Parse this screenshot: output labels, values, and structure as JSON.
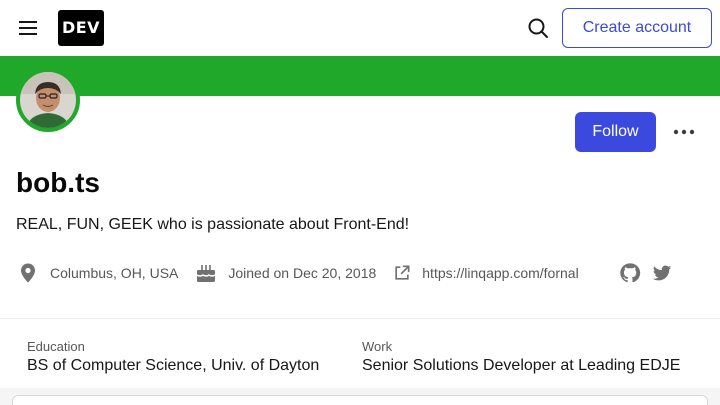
{
  "header": {
    "logo_text": "DEV",
    "create_account_label": "Create account"
  },
  "colors": {
    "brand_banner": "#20a82a",
    "accent": "#3b49df"
  },
  "profile": {
    "name": "bob.ts",
    "bio": "REAL, FUN, GEEK who is passionate about Front-End!",
    "follow_label": "Follow",
    "location": "Columbus, OH, USA",
    "joined": "Joined on Dec 20, 2018",
    "website": "https://linqapp.com/fornal",
    "icons": [
      "location-icon",
      "cake-icon",
      "external-link-icon",
      "github-icon",
      "twitter-icon"
    ]
  },
  "details": {
    "education_label": "Education",
    "education_value": "BS of Computer Science, Univ. of Dayton",
    "work_label": "Work",
    "work_value": "Senior Solutions Developer at Leading EDJE"
  }
}
